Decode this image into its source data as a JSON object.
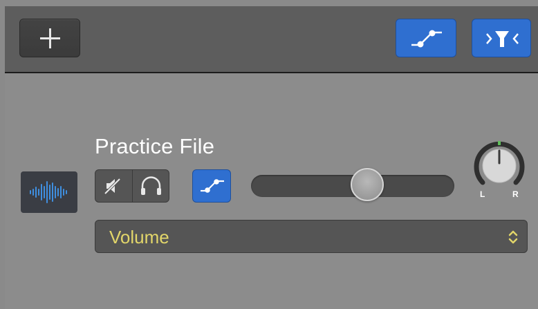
{
  "toolbar": {
    "add_icon": "plus-icon",
    "automation_icon": "automation-curve-icon",
    "filter_icon": "filter-icon",
    "accent_color": "#2f6fd0"
  },
  "track": {
    "name": "Practice File",
    "region_icon": "waveform-icon",
    "mute_icon": "speaker-muted-icon",
    "solo_icon": "headphones-icon",
    "automation_icon": "automation-curve-icon",
    "volume_level": 0.57,
    "pan": {
      "left_label": "L",
      "right_label": "R",
      "value": 0
    }
  },
  "automation": {
    "parameter": "Volume",
    "parameter_color": "#e2d66a",
    "stepper_icon": "chevron-up-down-icon"
  }
}
